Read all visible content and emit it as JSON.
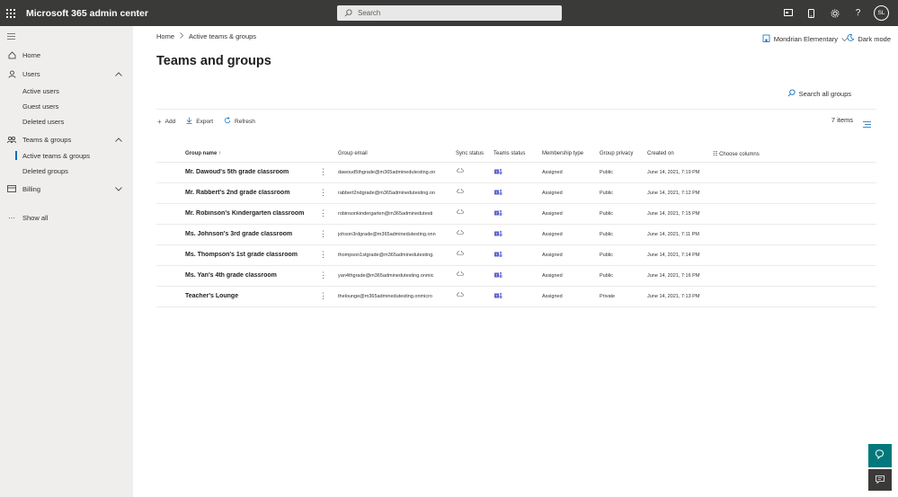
{
  "app": {
    "title": "Microsoft 365 admin center"
  },
  "search": {
    "placeholder": "Search"
  },
  "user": {
    "initials": "SL"
  },
  "topicons": [
    "screen-share-icon",
    "mobile-icon",
    "gear-icon",
    "help-icon"
  ],
  "sidebar": {
    "items": [
      {
        "label": "Home",
        "icon": "home-icon"
      },
      {
        "label": "Users",
        "icon": "person-icon",
        "expanded": true
      },
      {
        "label": "Active users"
      },
      {
        "label": "Guest users"
      },
      {
        "label": "Deleted users"
      },
      {
        "label": "Teams & groups",
        "icon": "teams-groups-icon",
        "expanded": true
      },
      {
        "label": "Active teams & groups",
        "selected": true
      },
      {
        "label": "Deleted groups"
      },
      {
        "label": "Billing",
        "icon": "credit-card-icon",
        "expanded": false
      },
      {
        "label": "Show all",
        "icon": "ellipsis-icon"
      }
    ]
  },
  "breadcrumb": {
    "home": "Home",
    "current": "Active teams & groups"
  },
  "header": {
    "tenant": "Mondrian Elementary",
    "dark_mode": "Dark mode"
  },
  "page": {
    "title": "Teams and groups",
    "search_all": "Search all groups",
    "items_count": "7 items"
  },
  "commands": {
    "add": "Add",
    "export": "Export",
    "refresh": "Refresh"
  },
  "table": {
    "columns": {
      "name": "Group name",
      "email": "Group email",
      "sync": "Sync status",
      "teams": "Teams status",
      "mtype": "Membership type",
      "privacy": "Group privacy",
      "created": "Created on",
      "choose": "Choose columns"
    },
    "rows": [
      {
        "name": "Mr. Dawoud's 5th grade classroom",
        "email": "dawoud5thgrade@m365adminedutesting.on",
        "mtype": "Assigned",
        "privacy": "Public",
        "created": "June 14, 2021, 7:19 PM"
      },
      {
        "name": "Mr. Rabbert's 2nd grade classroom",
        "email": "rabbert2ndgrade@m365adminedutesting.on",
        "mtype": "Assigned",
        "privacy": "Public",
        "created": "June 14, 2021, 7:12 PM"
      },
      {
        "name": "Mr. Robinson's Kindergarten classroom",
        "email": "robinsonkindergarten@m365adminedutesti",
        "mtype": "Assigned",
        "privacy": "Public",
        "created": "June 14, 2021, 7:15 PM"
      },
      {
        "name": "Ms. Johnson's 3rd grade classroom",
        "email": "johson3rdgrade@m365adminedutesting.onn",
        "mtype": "Assigned",
        "privacy": "Public",
        "created": "June 14, 2021, 7:11 PM"
      },
      {
        "name": "Ms. Thompson's 1st grade classroom",
        "email": "thompson1stgrade@m365adminedutesting.",
        "mtype": "Assigned",
        "privacy": "Public",
        "created": "June 14, 2021, 7:14 PM"
      },
      {
        "name": "Ms. Yan's 4th grade classroom",
        "email": "yan4thgrade@m365adminedutesting.onmic",
        "mtype": "Assigned",
        "privacy": "Public",
        "created": "June 14, 2021, 7:16 PM"
      },
      {
        "name": "Teacher's Lounge",
        "email": "thelounge@m365adminedutesting.onmicro",
        "mtype": "Assigned",
        "privacy": "Private",
        "created": "June 14, 2021, 7:13 PM"
      }
    ]
  },
  "colors": {
    "topbar": "#3a3a38",
    "sidebar": "#efeeed",
    "accent": "#0f6cbd",
    "teal": "#03787c"
  }
}
